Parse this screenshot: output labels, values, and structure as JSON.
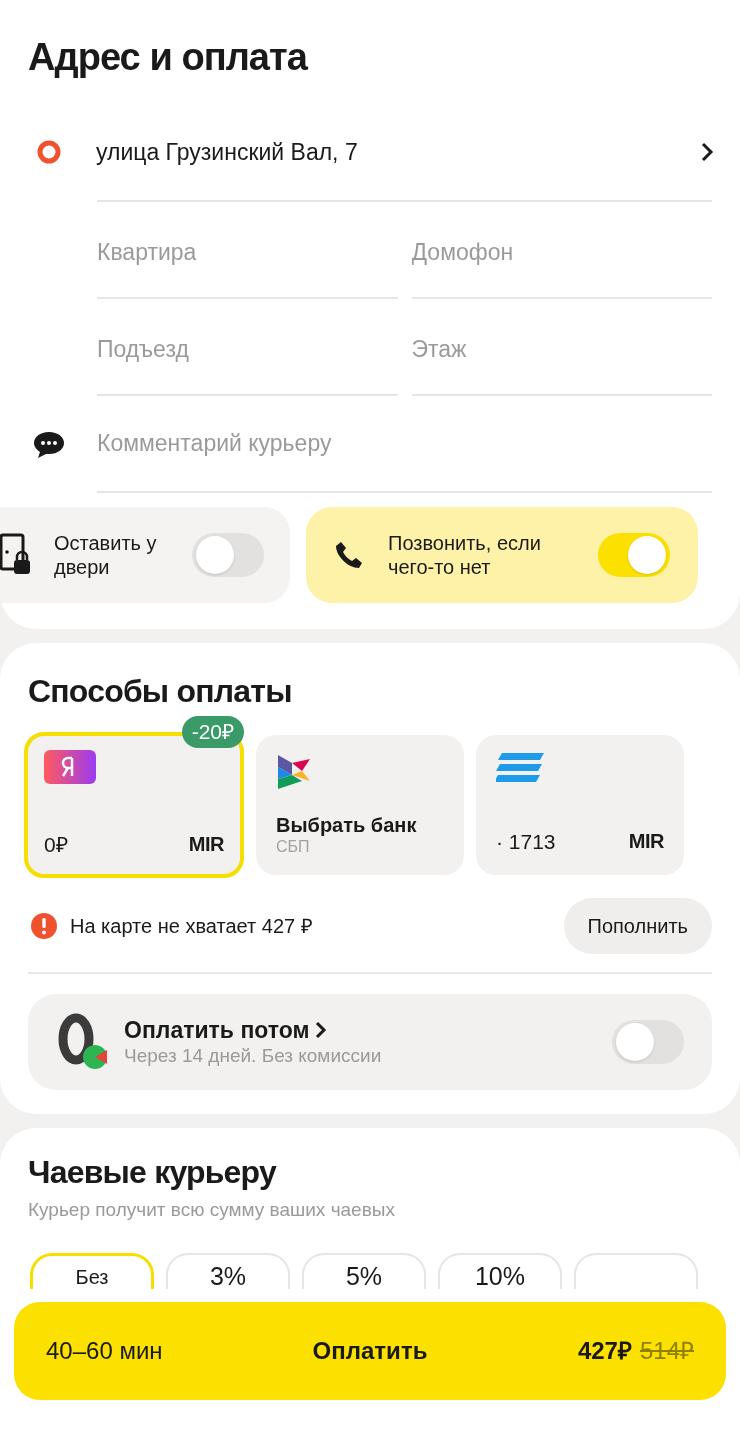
{
  "address": {
    "title": "Адрес и оплата",
    "street": "улица Грузинский Вал, 7",
    "fields": [
      {
        "placeholder": "Квартира"
      },
      {
        "placeholder": "Домофон"
      },
      {
        "placeholder": "Подъезд"
      },
      {
        "placeholder": "Этаж"
      }
    ],
    "comment": {
      "placeholder": "Комментарий курьеру"
    },
    "options": [
      {
        "kind": "door",
        "label": "Оставить у двери",
        "on": false
      },
      {
        "kind": "phone",
        "label": "Позвонить, если чего-то нет",
        "on": true
      }
    ]
  },
  "payment": {
    "title": "Способы оплаты",
    "methods": [
      {
        "kind": "yandex",
        "amount": "0₽",
        "network": "MIR",
        "badge": "-20₽",
        "selected": true
      },
      {
        "kind": "sbp",
        "label": "Выбрать банк",
        "sublabel": "СБП",
        "selected": false
      },
      {
        "kind": "card",
        "amount": "· 1713",
        "network": "MIR",
        "selected": false
      }
    ],
    "warning": "На карте не хватает 427 ₽",
    "topup": "Пополнить",
    "pay_later": {
      "title": "Оплатить потом",
      "subtitle": "Через 14 дней. Без комиссии",
      "on": false
    }
  },
  "tips": {
    "title": "Чаевые курьеру",
    "subtitle": "Курьер получит всю сумму ваших чаевых",
    "options": [
      {
        "label": "Без",
        "selected": true
      },
      {
        "label": "3%",
        "selected": false
      },
      {
        "label": "5%",
        "selected": false
      },
      {
        "label": "10%",
        "selected": false
      },
      {
        "selected": false
      }
    ]
  },
  "checkout": {
    "time": "40–60 мин",
    "action": "Оплатить",
    "price": "427₽",
    "old_price": "514₽"
  }
}
